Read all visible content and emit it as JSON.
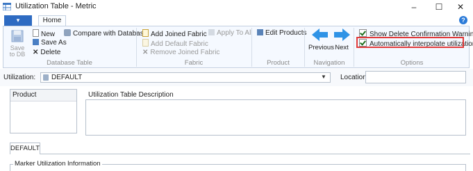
{
  "window": {
    "title": "Utilization Table - Metric",
    "minimize": "–",
    "maximize": "☐",
    "close": "✕"
  },
  "tabs": {
    "file": "▾",
    "home": "Home"
  },
  "help": "?",
  "ribbon": {
    "database_table": {
      "label": "Database Table",
      "save_to_db": [
        "Save",
        "to DB"
      ],
      "new": "New",
      "save_as": "Save As",
      "delete": "Delete",
      "compare": "Compare with Database"
    },
    "fabric": {
      "label": "Fabric",
      "add_joined": "Add Joined Fabric",
      "apply_to_all": "Apply To All",
      "add_default": "Add Default Fabric",
      "remove_joined": "Remove Joined Fabric"
    },
    "product": {
      "label": "Product",
      "edit_products": "Edit Products"
    },
    "navigation": {
      "label": "Navigation",
      "previous": "Previous",
      "next": "Next"
    },
    "options": {
      "label": "Options",
      "show_delete_confirmation": "Show Delete Confirmation Warning",
      "auto_interpolate": "Automatically interpolate utilizations"
    }
  },
  "utilization": {
    "label": "Utilization:",
    "value": "DEFAULT"
  },
  "location": {
    "label": "Location",
    "value": ""
  },
  "product_panel": {
    "header": "Product"
  },
  "description": {
    "label": "Utilization Table Description",
    "value": ""
  },
  "bottom_tab": "DEFAULT",
  "marker_group": "Marker Utilization Information",
  "colors": {
    "accent": "#2e6bc2",
    "highlight": "#e03a3a"
  }
}
